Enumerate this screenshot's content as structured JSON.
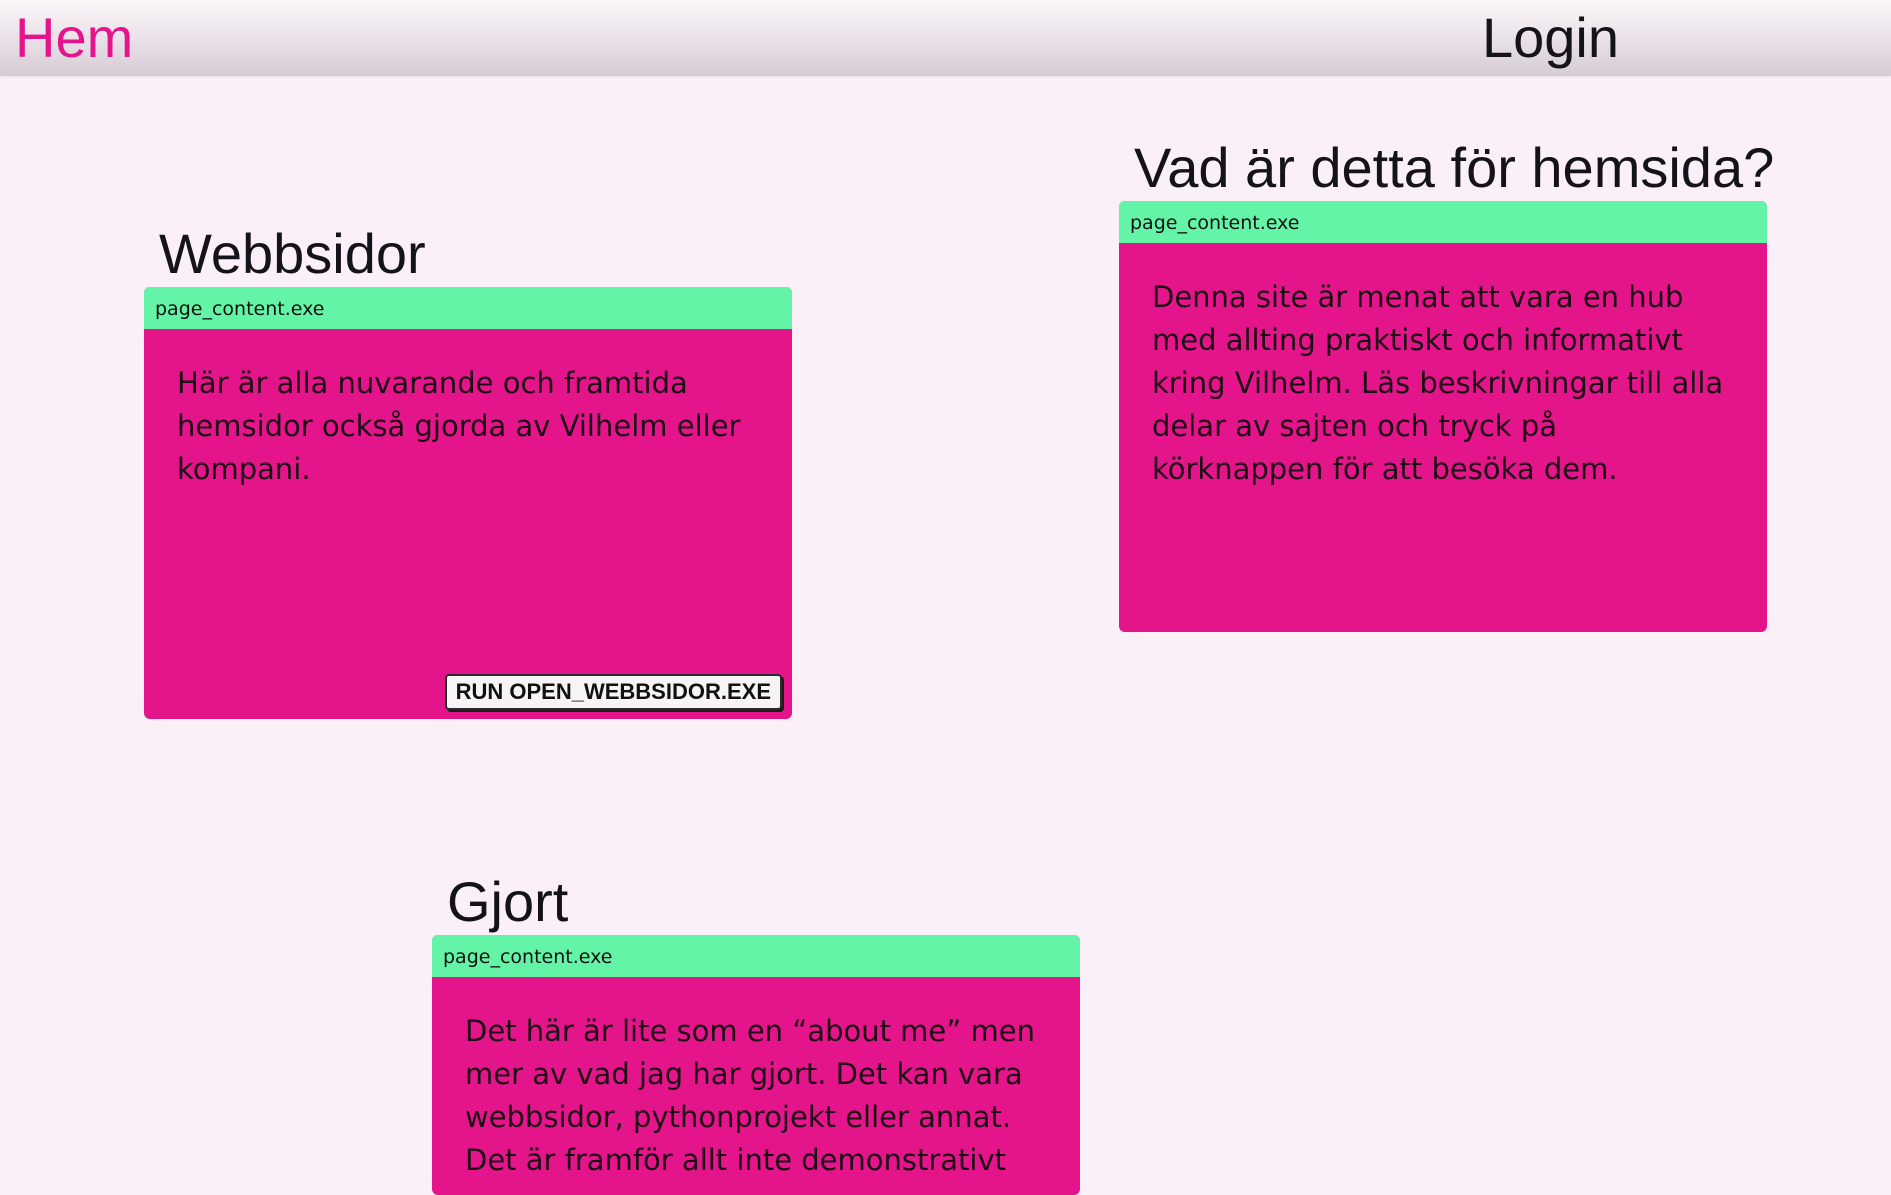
{
  "nav": {
    "home_label": "Hem",
    "login_label": "Login"
  },
  "sections": {
    "webbsidor": {
      "title": "Webbsidor",
      "window_title": "page_content.exe",
      "body": "Här är alla nuvarande och framtida hemsidor också gjorda av Vilhelm eller kompani.",
      "button_label": "RUN OPEN_WEBBSIDOR.EXE"
    },
    "about_site": {
      "title": "Vad är detta för hemsida?",
      "window_title": "page_content.exe",
      "body": "Denna site är menat att vara en hub med allting praktiskt och informativt kring Vilhelm. Läs beskrivningar till alla delar av sajten och tryck på körknappen för att besöka dem."
    },
    "gjort": {
      "title": "Gjort",
      "window_title": "page_content.exe",
      "body": "Det här är lite som en “about me” men mer av vad jag har gjort. Det kan vara webbsidor, pythonprojekt eller annat. Det är framför allt inte demonstrativt"
    }
  },
  "colors": {
    "accent_pink": "#e4148b",
    "window_bar_green": "#64f4a8",
    "page_background": "#fcf0f8"
  }
}
